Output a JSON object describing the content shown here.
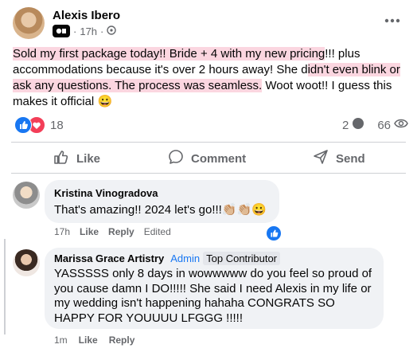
{
  "post": {
    "author": "Alexis Ibero",
    "time": "17h",
    "text_parts": [
      "Sold my first package today!! Bride + 4 with my new pricing",
      "!!! plus accommodations because it's over 2 hours away! She d",
      "idn't even blink or ask any questions. The process was seamless.",
      " Woot woot!! I guess this makes it official "
    ],
    "emoji": "😀",
    "reaction_count": "18",
    "comment_count": "2",
    "share_count": "66"
  },
  "actions": {
    "like": "Like",
    "comment": "Comment",
    "send": "Send"
  },
  "comments": [
    {
      "author": "Kristina Vinogradova",
      "text": "That's amazing!! 2024 let's go!!!",
      "emoji": "👏🏼👏🏼😀",
      "time": "17h",
      "like": "Like",
      "reply": "Reply",
      "edited": "Edited"
    },
    {
      "author": "Marissa Grace Artistry",
      "badge_admin": "Admin",
      "badge_top": "Top Contributor",
      "text": "YASSSSS only 8 days in wowwwww do you feel so proud of you cause damn I DO!!!!! She said I need Alexis in my life or my wedding isn't happening hahaha CONGRATS SO HAPPY FOR YOUUUU LFGGG !!!!!",
      "time": "1m",
      "like": "Like",
      "reply": "Reply"
    }
  ],
  "colors": {
    "accent": "#1877f2",
    "highlight": "#fbd6e0",
    "bubble": "#f0f2f5",
    "muted": "#65676b"
  }
}
